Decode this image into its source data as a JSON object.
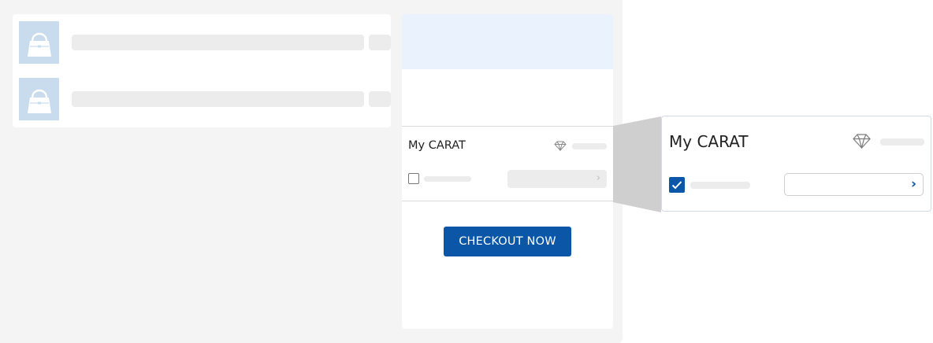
{
  "colors": {
    "accent": "#0b56a7",
    "background": "#f4f4f4",
    "skeleton": "#ececec",
    "summary_header": "#eaf3fd",
    "thumbnail": "#c9dcee"
  },
  "cart": {
    "items": [
      {
        "icon": "handbag-icon"
      },
      {
        "icon": "handbag-icon"
      }
    ]
  },
  "summary": {
    "carat_title": "My CARAT",
    "carat_icon": "diamond-icon",
    "use_points_checked": false,
    "redeem_chevron": "›",
    "checkout_label": "CHECKOUT NOW"
  },
  "zoom": {
    "carat_title": "My CARAT",
    "carat_icon": "diamond-icon",
    "use_points_checked": true,
    "redeem_chevron": "›"
  }
}
